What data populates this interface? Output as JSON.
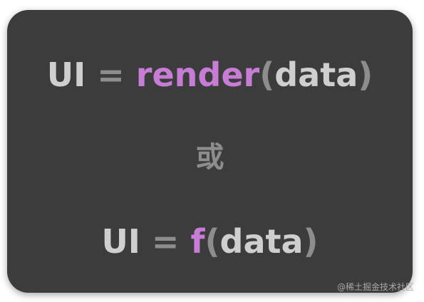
{
  "formula_1": {
    "ui": "UI",
    "equals": "=",
    "func": "render",
    "open_paren": "(",
    "arg": "data",
    "close_paren": ")"
  },
  "separator": "或",
  "formula_2": {
    "ui": "UI",
    "equals": "=",
    "func": "f",
    "open_paren": "(",
    "arg": "data",
    "close_paren": ")"
  },
  "watermark": "@稀土掘金技术社区",
  "colors": {
    "background": "#3c3c3c",
    "text_light": "#cfcfcf",
    "text_gray": "#8d8d8d",
    "accent_purple": "#c77dd6"
  }
}
